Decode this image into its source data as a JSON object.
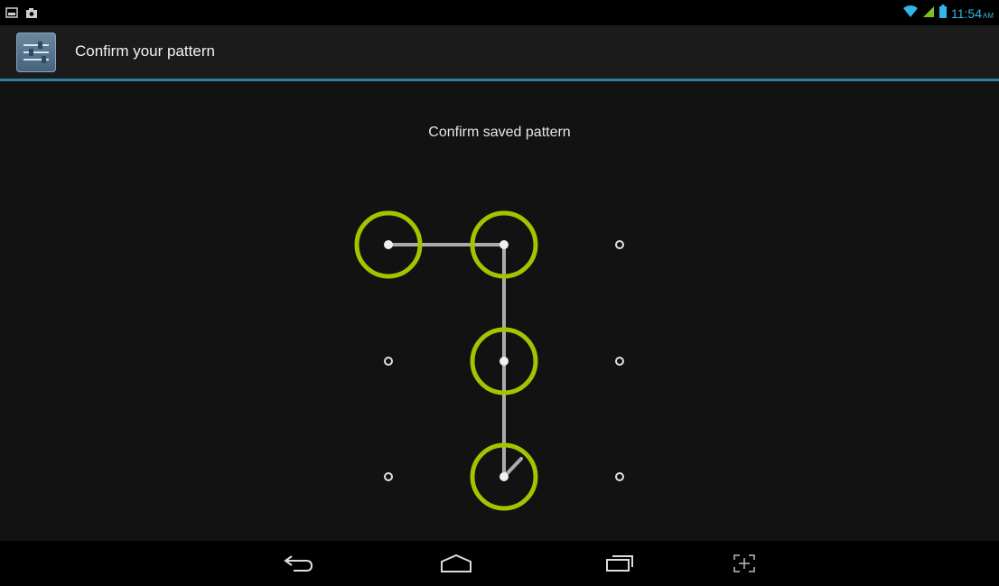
{
  "status_bar": {
    "time": "11:54",
    "ampm": "AM",
    "left_icons": [
      "picture-notification-icon",
      "camera-notification-icon"
    ],
    "right_icons": [
      "wifi-icon",
      "signal-icon",
      "battery-icon"
    ]
  },
  "action_bar": {
    "title": "Confirm your pattern",
    "icon": "settings-sliders-icon"
  },
  "prompt": "Confirm saved pattern",
  "pattern": {
    "grid": "3x3",
    "selected_dots": [
      1,
      2,
      5,
      8
    ],
    "accent_color": "#a4c400",
    "line_color": "#bdbdbd"
  },
  "nav_bar": {
    "buttons": [
      "back-icon",
      "home-icon",
      "recent-apps-icon",
      "screenshot-icon"
    ]
  },
  "colors": {
    "background": "#121212",
    "status_accent": "#33b5e5",
    "action_bar_divider": "#2f7f9e"
  }
}
